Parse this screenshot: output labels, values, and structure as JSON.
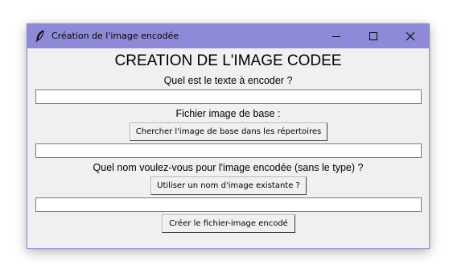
{
  "window": {
    "title": "Création de l'image encodée",
    "icon": "feather-icon",
    "controls": [
      "minimize-icon",
      "maximize-icon",
      "close-icon"
    ]
  },
  "form": {
    "heading": "CREATION DE L'IMAGE CODEE",
    "text_prompt": "Quel est le texte à encoder ?",
    "text_value": "",
    "base_image_label": "Fichier image de base :",
    "browse_button": "Chercher l'image de base dans les répertoires",
    "base_image_value": "",
    "name_prompt": "Quel nom voulez-vous pour l'image encodée (sans le type) ?",
    "existing_name_button": "Utiliser un nom d'image existante ?",
    "name_value": "",
    "create_button": "Créer le fichier-image encodé"
  },
  "colors": {
    "titlebar": "#8f8ad8",
    "window_bg": "#f0f0f0"
  }
}
